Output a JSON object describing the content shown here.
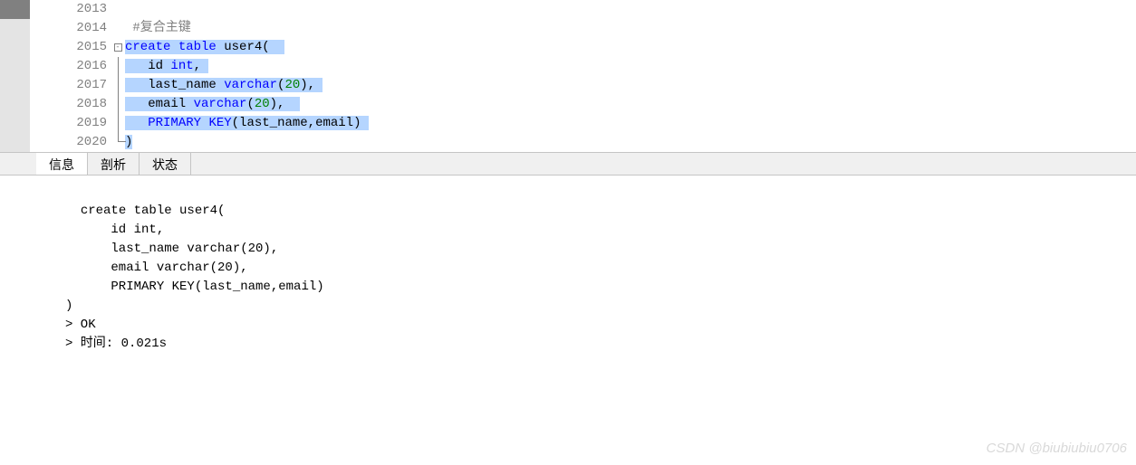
{
  "editor": {
    "lines": [
      {
        "num": "2013",
        "cursor": true,
        "fold": "",
        "tokens": []
      },
      {
        "num": "2014",
        "fold": "",
        "tokens": [
          {
            "cls": "plain",
            "sel": false,
            "t": " "
          },
          {
            "cls": "comment",
            "sel": false,
            "t": "#复合主键"
          }
        ]
      },
      {
        "num": "2015",
        "fold": "minus",
        "tokens": [
          {
            "cls": "keyword",
            "sel": true,
            "t": "create"
          },
          {
            "cls": "plain",
            "sel": true,
            "t": " "
          },
          {
            "cls": "keyword",
            "sel": true,
            "t": "table"
          },
          {
            "cls": "plain",
            "sel": true,
            "t": " user4("
          },
          {
            "cls": "plain",
            "sel": true,
            "t": "  "
          }
        ]
      },
      {
        "num": "2016",
        "fold": "line",
        "tokens": [
          {
            "cls": "plain",
            "sel": true,
            "t": "   id "
          },
          {
            "cls": "type",
            "sel": true,
            "t": "int"
          },
          {
            "cls": "plain",
            "sel": true,
            "t": ","
          },
          {
            "cls": "plain",
            "sel": true,
            "t": " "
          }
        ]
      },
      {
        "num": "2017",
        "fold": "line",
        "tokens": [
          {
            "cls": "plain",
            "sel": true,
            "t": "   last_name "
          },
          {
            "cls": "type",
            "sel": true,
            "t": "varchar"
          },
          {
            "cls": "plain",
            "sel": true,
            "t": "("
          },
          {
            "cls": "number",
            "sel": true,
            "t": "20"
          },
          {
            "cls": "plain",
            "sel": true,
            "t": "),"
          },
          {
            "cls": "plain",
            "sel": true,
            "t": " "
          }
        ]
      },
      {
        "num": "2018",
        "fold": "line",
        "tokens": [
          {
            "cls": "plain",
            "sel": true,
            "t": "   email "
          },
          {
            "cls": "type",
            "sel": true,
            "t": "varchar"
          },
          {
            "cls": "plain",
            "sel": true,
            "t": "("
          },
          {
            "cls": "number",
            "sel": true,
            "t": "20"
          },
          {
            "cls": "plain",
            "sel": true,
            "t": "),"
          },
          {
            "cls": "plain",
            "sel": true,
            "t": "  "
          }
        ]
      },
      {
        "num": "2019",
        "fold": "line",
        "tokens": [
          {
            "cls": "plain",
            "sel": true,
            "t": "   "
          },
          {
            "cls": "keyword",
            "sel": true,
            "t": "PRIMARY"
          },
          {
            "cls": "plain",
            "sel": true,
            "t": " "
          },
          {
            "cls": "keyword",
            "sel": true,
            "t": "KEY"
          },
          {
            "cls": "plain",
            "sel": true,
            "t": "(last_name,email)"
          },
          {
            "cls": "plain",
            "sel": true,
            "t": " "
          }
        ]
      },
      {
        "num": "2020",
        "fold": "end",
        "tokens": [
          {
            "cls": "plain",
            "sel": true,
            "t": ")"
          }
        ]
      }
    ]
  },
  "tabs": {
    "items": [
      {
        "label": "信息",
        "active": true
      },
      {
        "label": "剖析",
        "active": false
      },
      {
        "label": "状态",
        "active": false
      }
    ]
  },
  "output": {
    "text": "create table user4(  \n      id int, \n      last_name varchar(20), \n      email varchar(20),  \n      PRIMARY KEY(last_name,email) \n)\n> OK\n> 时间: 0.021s"
  },
  "watermark": "CSDN @biubiubiu0706"
}
